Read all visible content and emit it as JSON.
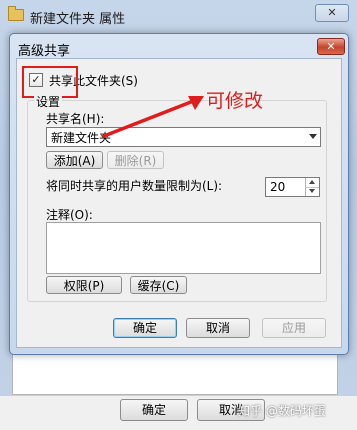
{
  "back_window": {
    "title": "新建文件夹 属性",
    "close_glyph": "✕",
    "buttons": {
      "ok": "确定",
      "cancel": "取消"
    }
  },
  "dialog": {
    "title": "高级共享",
    "close_glyph": "✕",
    "share_checkbox": {
      "label": "共享此文件夹(S)",
      "checked": true,
      "mark": "✓"
    },
    "settings_group": "设置",
    "share_name_label": "共享名(H):",
    "share_name_value": "新建文件夹",
    "add_button": "添加(A)",
    "remove_button": "删除(R)",
    "user_limit_label": "将同时共享的用户数量限制为(L):",
    "user_limit_value": "20",
    "comment_label": "注释(O):",
    "comment_value": "",
    "permissions_button": "权限(P)",
    "caching_button": "缓存(C)",
    "footer": {
      "ok": "确定",
      "cancel": "取消",
      "apply": "应用"
    }
  },
  "annotation": {
    "text": "可修改",
    "color": "#e01d1d"
  },
  "watermark": "知乎 @数码坏蛋"
}
